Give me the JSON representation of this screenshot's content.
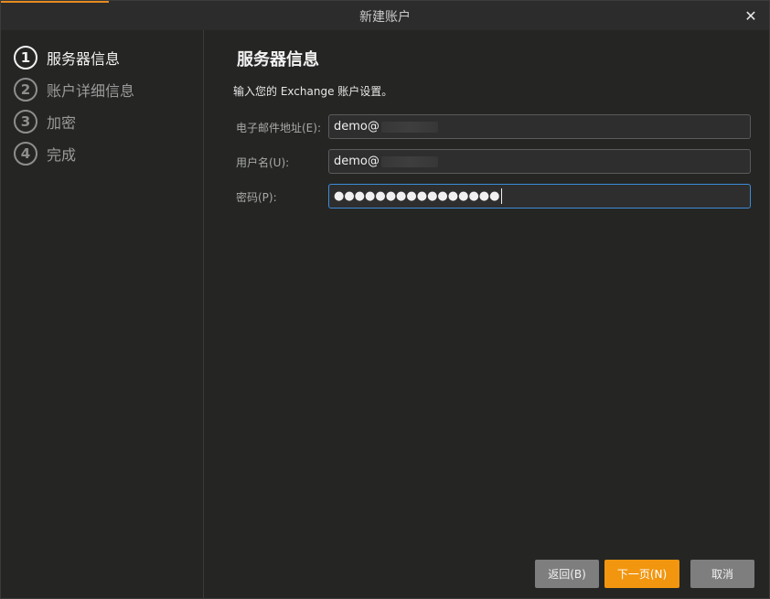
{
  "window": {
    "title": "新建账户"
  },
  "steps": [
    {
      "number": "1",
      "label": "服务器信息",
      "active": true
    },
    {
      "number": "2",
      "label": "账户详细信息",
      "active": false
    },
    {
      "number": "3",
      "label": "加密",
      "active": false
    },
    {
      "number": "4",
      "label": "完成",
      "active": false
    }
  ],
  "main": {
    "heading": "服务器信息",
    "subtitle": "输入您的 Exchange 账户设置。"
  },
  "form": {
    "email_label": "电子邮件地址(E):",
    "email_value": "demo@",
    "username_label": "用户名(U):",
    "username_value": "demo@",
    "password_label": "密码(P):",
    "password_value": "●●●●●●●●●●●●●●●●"
  },
  "buttons": {
    "back": "返回(B)",
    "next": "下一页(N)",
    "cancel": "取消"
  },
  "colors": {
    "accent": "#f2960f",
    "focus": "#3d8bd8",
    "background": "#252624"
  },
  "icons": {
    "close": "close-icon"
  }
}
